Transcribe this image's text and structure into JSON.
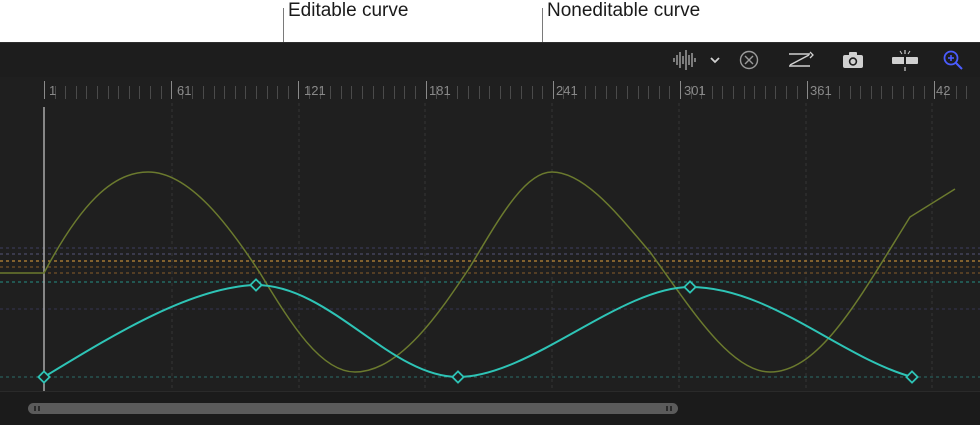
{
  "callouts": {
    "editable": "Editable curve",
    "noneditable": "Noneditable curve"
  },
  "toolbar": {
    "icons": [
      "waveform-icon",
      "chevron-down-icon",
      "clear-curve-icon",
      "fit-curve-icon",
      "snapshot-camera-icon",
      "split-clip-icon",
      "zoom-icon"
    ]
  },
  "ruler": {
    "labels": [
      "1",
      "61",
      "121",
      "181",
      "241",
      "301",
      "361",
      "42"
    ]
  },
  "colors": {
    "editable_curve": "#2ec4b6",
    "noneditable_curve": "#6b7a2e",
    "orange_line": "#e6a33c",
    "zoom_icon": "#4b5cff"
  }
}
